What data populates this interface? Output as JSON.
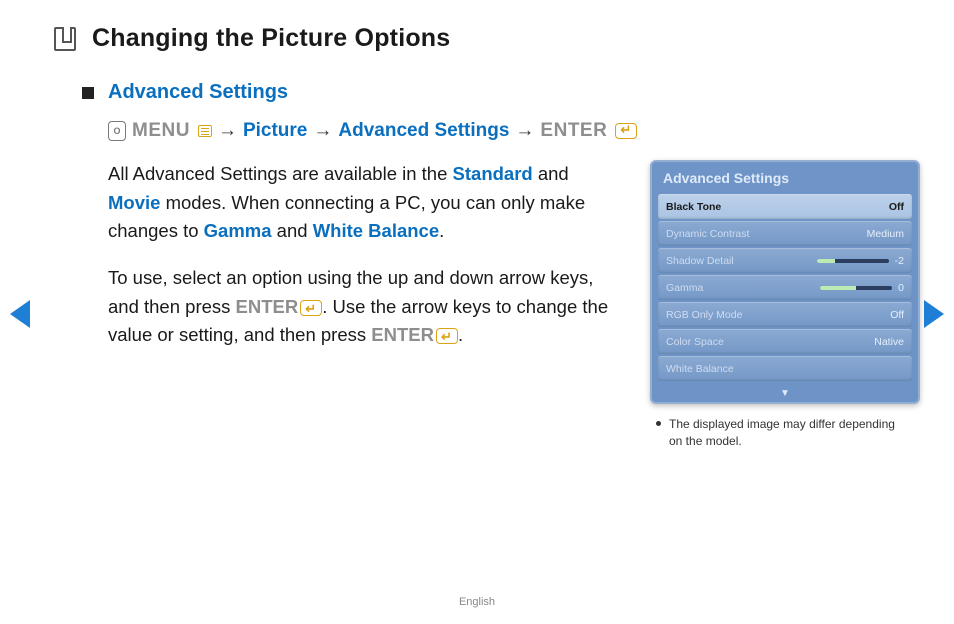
{
  "page": {
    "title": "Changing the Picture Options",
    "language": "English"
  },
  "section": {
    "title": "Advanced Settings"
  },
  "breadcrumb": {
    "menu": "MENU",
    "picture": "Picture",
    "advanced": "Advanced Settings",
    "enter": "ENTER"
  },
  "body": {
    "p1a": "All Advanced Settings are available in the ",
    "p1_standard": "Standard",
    "p1b": " and ",
    "p1_movie": "Movie",
    "p1c": " modes. When connecting a PC, you can only make changes to ",
    "p1_gamma": "Gamma",
    "p1d": " and ",
    "p1_wb": "White Balance",
    "p1e": ".",
    "p2a": "To use, select an option using the up and down arrow keys, and then press ",
    "p2_enter1": "ENTER",
    "p2b": ". Use the arrow keys to change the value or setting, and then press ",
    "p2_enter2": "ENTER",
    "p2c": "."
  },
  "panel": {
    "title": "Advanced Settings",
    "rows": [
      {
        "label": "Black Tone",
        "value": "Off"
      },
      {
        "label": "Dynamic Contrast",
        "value": "Medium"
      },
      {
        "label": "Shadow Detail",
        "value": "-2"
      },
      {
        "label": "Gamma",
        "value": "0"
      },
      {
        "label": "RGB Only Mode",
        "value": "Off"
      },
      {
        "label": "Color Space",
        "value": "Native"
      },
      {
        "label": "White Balance",
        "value": ""
      }
    ],
    "more": "▼"
  },
  "caption": "The displayed image may differ depending on the model."
}
